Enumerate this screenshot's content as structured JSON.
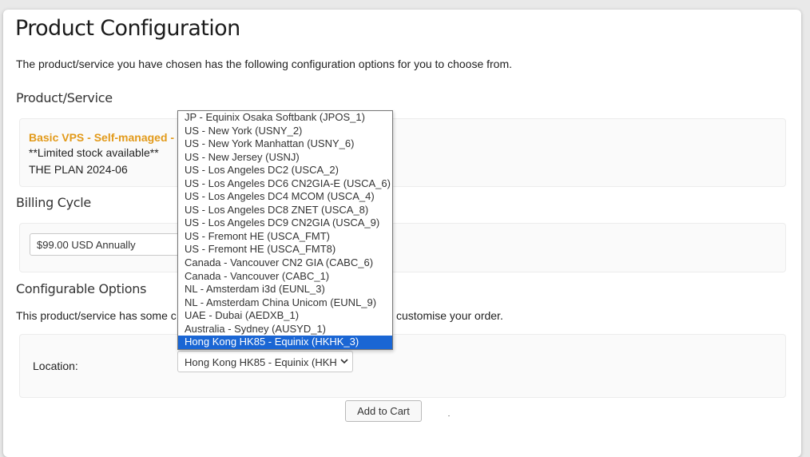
{
  "page": {
    "title": "Product Configuration",
    "intro": "The product/service you have chosen has the following configuration options for you to choose from."
  },
  "product_service": {
    "heading": "Product/Service",
    "name": "Basic VPS - Self-managed -",
    "stock_note": "**Limited stock available**",
    "plan": "THE PLAN 2024-06"
  },
  "billing": {
    "heading": "Billing Cycle",
    "selected": "$99.00 USD Annually"
  },
  "configurable": {
    "heading": "Configurable Options",
    "description_left": "This product/service has some c",
    "description_right": "customise your order.",
    "location_label": "Location:",
    "location_selected": "Hong Kong HK85 - Equinix (HKH",
    "options": [
      "JP - Equinix Osaka Softbank (JPOS_1)",
      "US - New York (USNY_2)",
      "US - New York Manhattan (USNY_6)",
      "US - New Jersey (USNJ)",
      "US - Los Angeles DC2 (USCA_2)",
      "US - Los Angeles DC6 CN2GIA-E (USCA_6)",
      "US - Los Angeles DC4 MCOM (USCA_4)",
      "US - Los Angeles DC8 ZNET (USCA_8)",
      "US - Los Angeles DC9 CN2GIA (USCA_9)",
      "US - Fremont HE (USCA_FMT)",
      "US - Fremont HE (USCA_FMT8)",
      "Canada - Vancouver CN2 GIA (CABC_6)",
      "Canada - Vancouver (CABC_1)",
      "NL - Amsterdam i3d (EUNL_3)",
      "NL - Amsterdam China Unicom (EUNL_9)",
      "UAE - Dubai (AEDXB_1)",
      "Australia - Sydney (AUSYD_1)",
      "Hong Kong HK85 - Equinix (HKHK_3)"
    ],
    "highlighted_index": 17
  },
  "actions": {
    "add_to_cart": "Add to Cart"
  },
  "colors": {
    "accent_product": "#e29a1a",
    "highlight": "#1a66d4"
  }
}
